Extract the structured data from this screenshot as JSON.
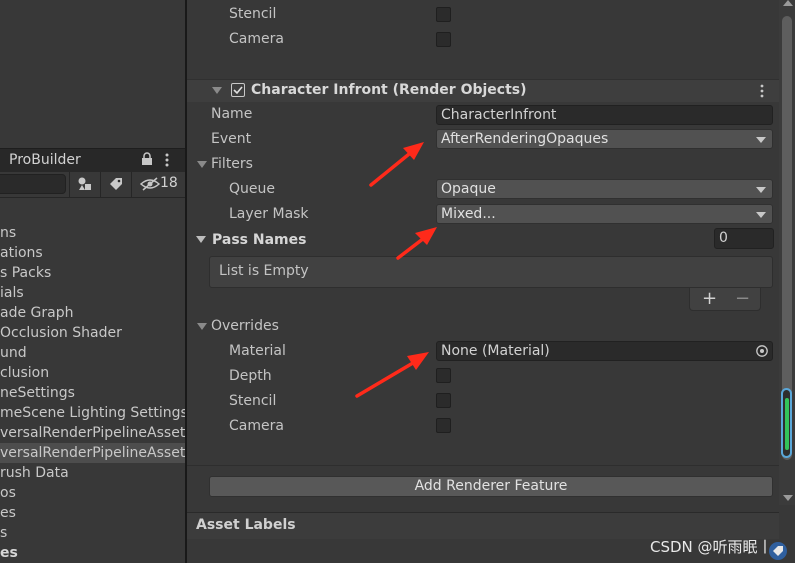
{
  "project_panel": {
    "tab_label": "ProBuilder",
    "hidden_count": "18",
    "items": [
      {
        "text": "ns",
        "selected": false,
        "bold": false
      },
      {
        "text": "ations",
        "selected": false,
        "bold": false
      },
      {
        "text": "s Packs",
        "selected": false,
        "bold": false
      },
      {
        "text": "ials",
        "selected": false,
        "bold": false
      },
      {
        "text": "ade Graph",
        "selected": false,
        "bold": false
      },
      {
        "text": "Occlusion Shader",
        "selected": false,
        "bold": false
      },
      {
        "text": "und",
        "selected": false,
        "bold": false
      },
      {
        "text": "clusion",
        "selected": false,
        "bold": false
      },
      {
        "text": "neSettings",
        "selected": false,
        "bold": false
      },
      {
        "text": "meScene Lighting Settings",
        "selected": false,
        "bold": false
      },
      {
        "text": "versalRenderPipelineAsset",
        "selected": false,
        "bold": false
      },
      {
        "text": "versalRenderPipelineAsset",
        "selected": true,
        "bold": false
      },
      {
        "text": "rush Data",
        "selected": false,
        "bold": false
      },
      {
        "text": "os",
        "selected": false,
        "bold": false
      },
      {
        "text": "es",
        "selected": false,
        "bold": false
      },
      {
        "text": "s",
        "selected": false,
        "bold": false
      },
      {
        "text": "es",
        "selected": false,
        "bold": true
      }
    ]
  },
  "inspector": {
    "top_rows": {
      "stencil_label": "Stencil",
      "camera_label": "Camera"
    },
    "feature": {
      "title": "Character Infront (Render Objects)",
      "enabled": true,
      "name_label": "Name",
      "name_value": "CharacterInfront",
      "event_label": "Event",
      "event_value": "AfterRenderingOpaques",
      "filters_label": "Filters",
      "queue_label": "Queue",
      "queue_value": "Opaque",
      "layer_mask_label": "Layer Mask",
      "layer_mask_value": "Mixed...",
      "pass_names_label": "Pass Names",
      "pass_names_count": "0",
      "list_empty_text": "List is Empty",
      "add_symbol": "+",
      "remove_symbol": "−",
      "overrides_label": "Overrides",
      "material_label": "Material",
      "material_value": "None (Material)",
      "depth_label": "Depth",
      "stencil_label": "Stencil",
      "camera_label": "Camera"
    },
    "add_renderer_feature_label": "Add Renderer Feature",
    "asset_labels_title": "Asset Labels"
  },
  "watermark": "CSDN @听雨眠丨",
  "colors": {
    "background": "#383838",
    "annotation_arrow": "#ff2a1a",
    "scroll_accent": "#33c45a",
    "scroll_border": "#5aa7d9"
  }
}
